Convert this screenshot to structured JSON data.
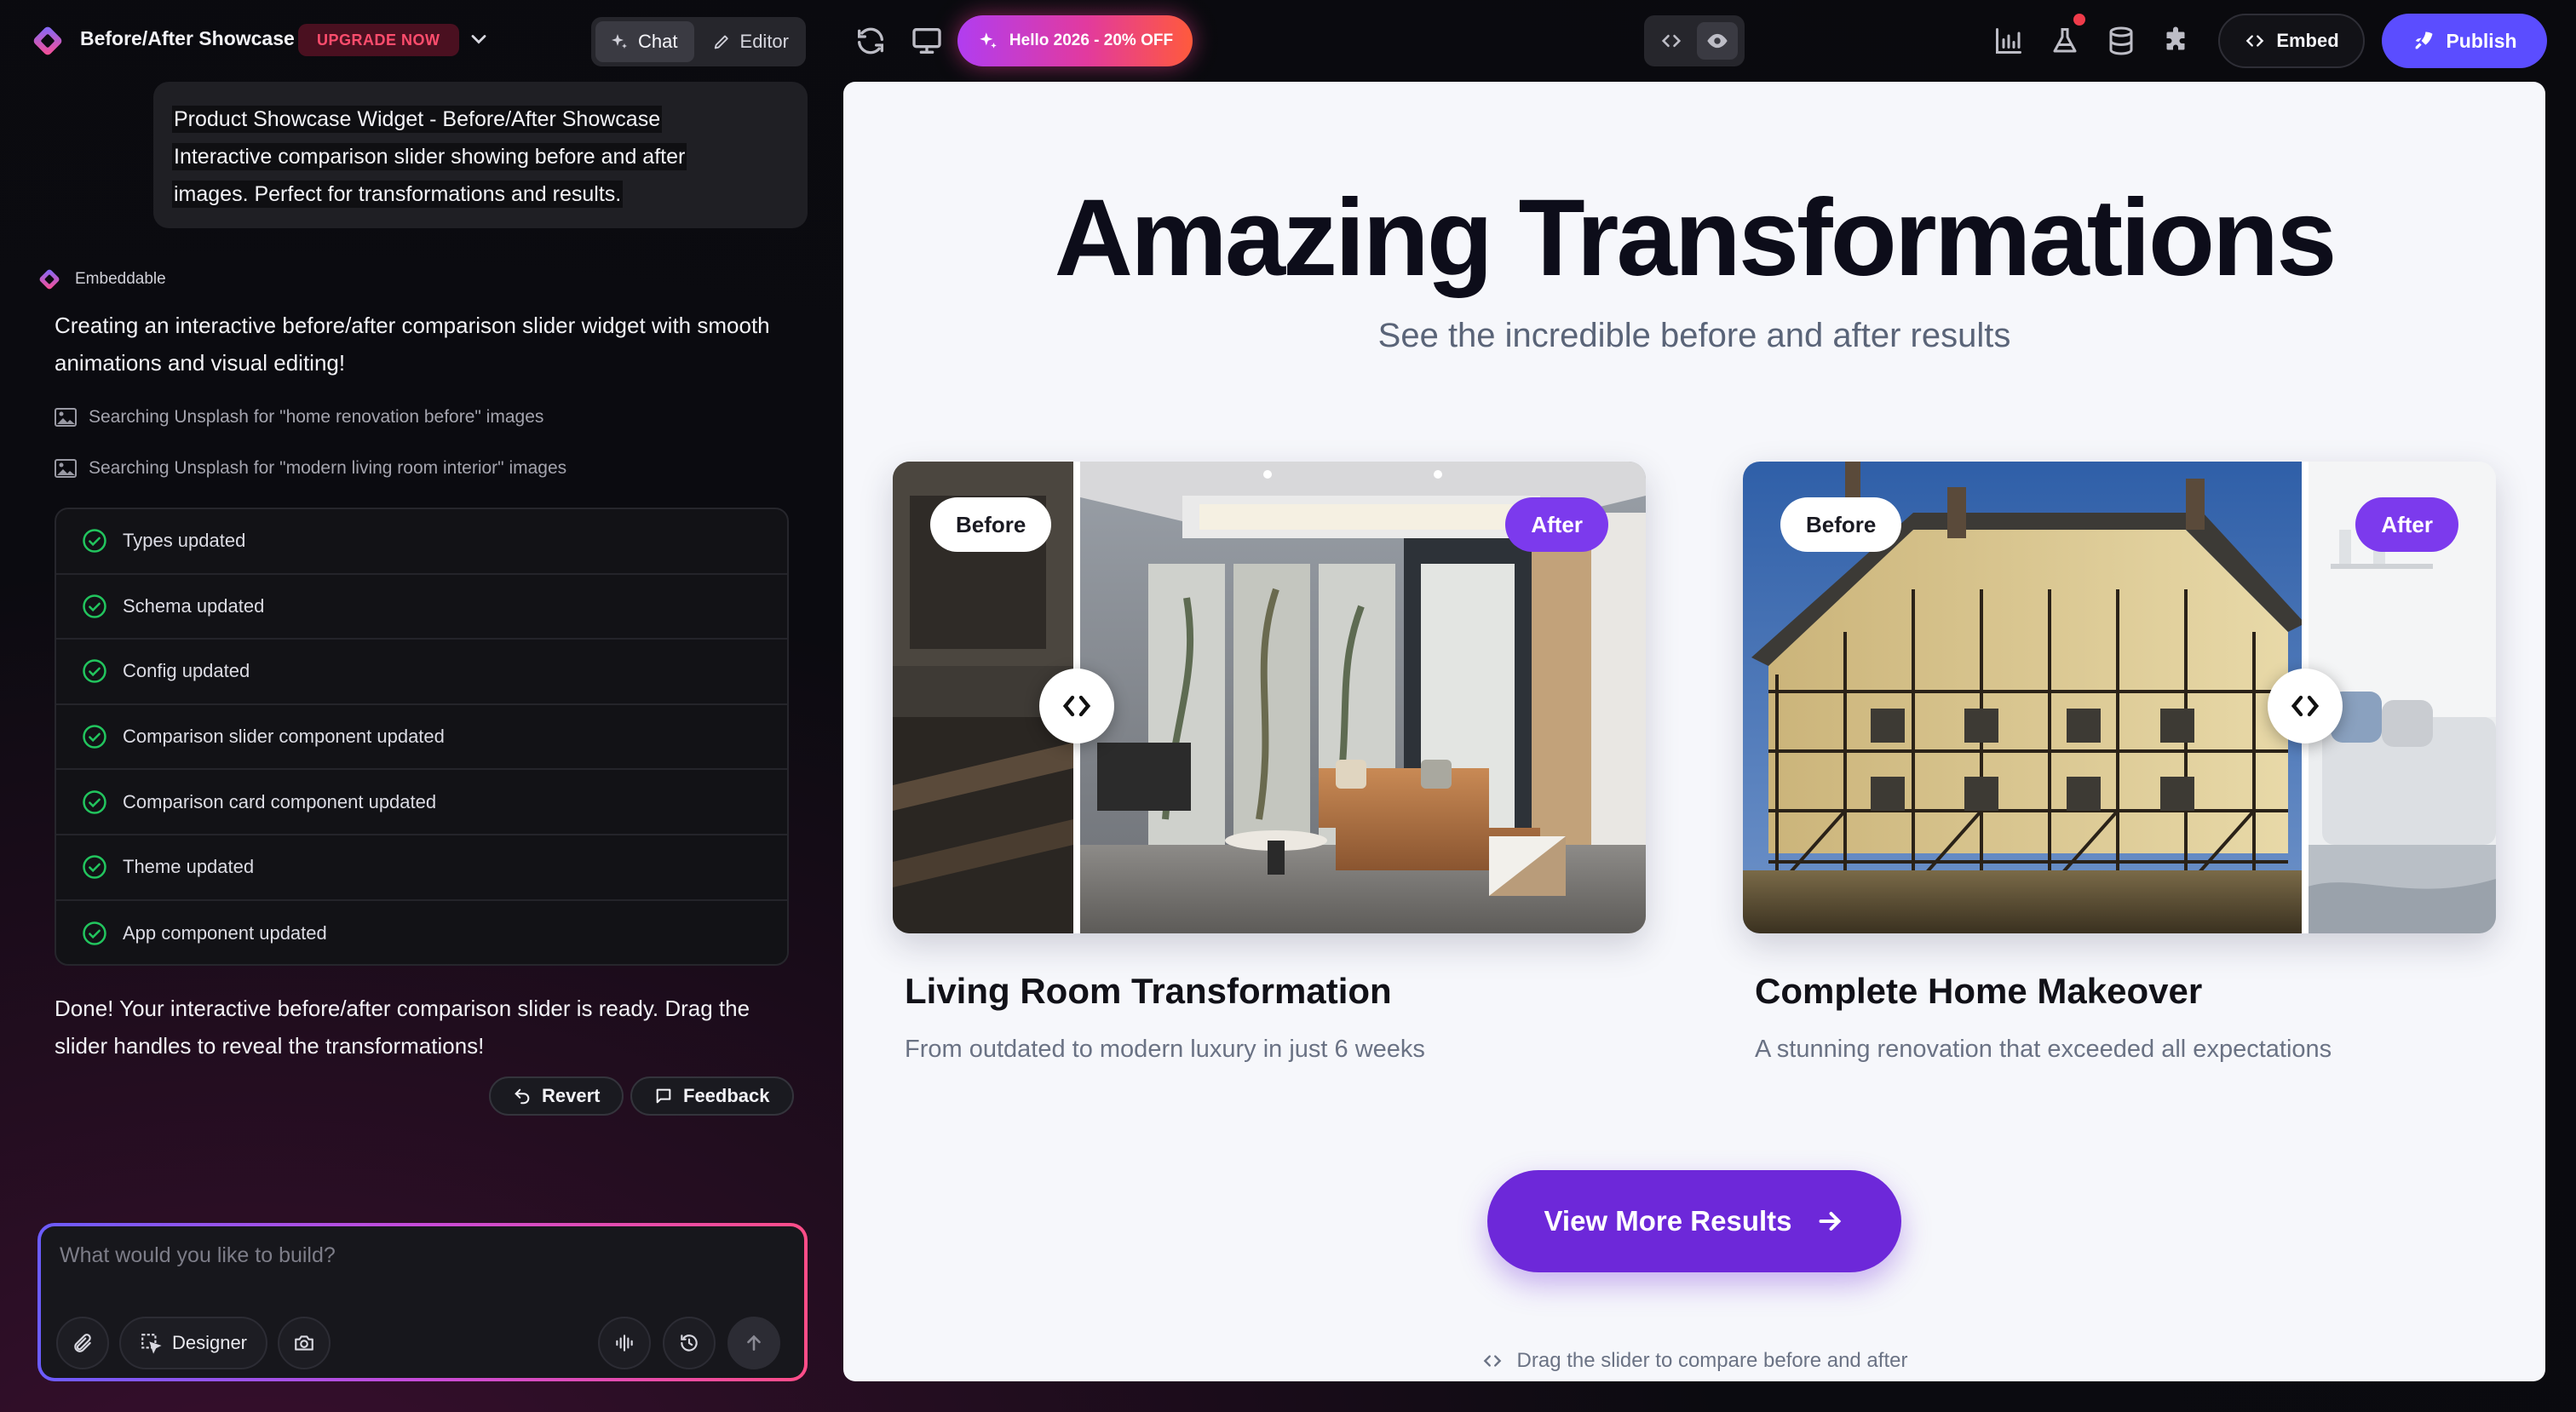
{
  "topbar": {
    "project_title": "Before/After Showcase",
    "upgrade_label": "UPGRADE NOW",
    "chat_label": "Chat",
    "editor_label": "Editor",
    "promo_label": "Hello 2026 - 20% OFF",
    "embed_label": "Embed",
    "publish_label": "Publish"
  },
  "chat": {
    "user_message": {
      "line1": "Product Showcase Widget - Before/After Showcase",
      "line2": "Interactive comparison slider showing before and after",
      "line3": "images. Perfect for transformations and results."
    },
    "bot_name": "Embeddable",
    "bot_intro": "Creating an interactive before/after comparison slider widget with smooth animations and visual editing!",
    "searches": [
      "Searching Unsplash for \"home renovation before\" images",
      "Searching Unsplash for \"modern living room interior\" images"
    ],
    "steps": [
      "Types updated",
      "Schema updated",
      "Config updated",
      "Comparison slider component updated",
      "Comparison card component updated",
      "Theme updated",
      "App component updated"
    ],
    "done_message": "Done! Your interactive before/after comparison slider is ready. Drag the slider handles to reveal the transformations!",
    "revert_label": "Revert",
    "feedback_label": "Feedback"
  },
  "composer": {
    "placeholder": "What would you like to build?",
    "designer_label": "Designer"
  },
  "preview": {
    "title": "Amazing Transformations",
    "subtitle": "See the incredible before and after results",
    "before_label": "Before",
    "after_label": "After",
    "cards": [
      {
        "title": "Living Room Transformation",
        "description": "From outdated to modern luxury in just 6 weeks"
      },
      {
        "title": "Complete Home Makeover",
        "description": "A stunning renovation that exceeded all expectations"
      }
    ],
    "cta_label": "View More Results",
    "hint": "Drag the slider to compare before and after"
  },
  "colors": {
    "accent": "#7c3aed",
    "publish": "#5b4dff",
    "success": "#22c55e",
    "upgrade": "#ff4d6d"
  }
}
